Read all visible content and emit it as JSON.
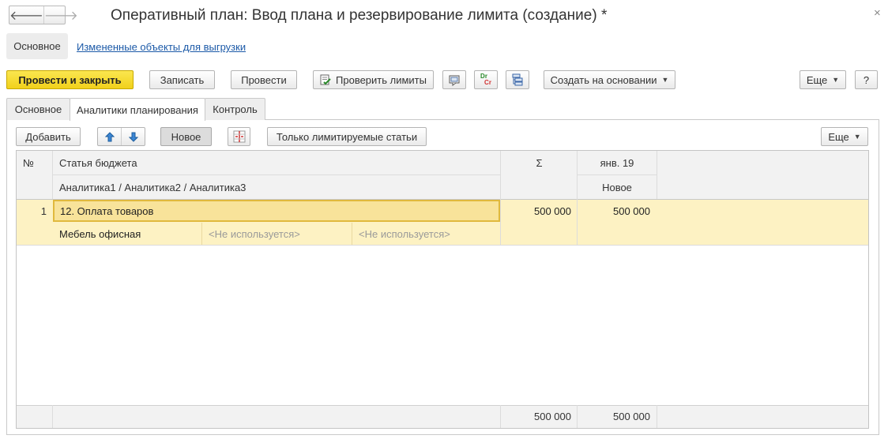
{
  "window": {
    "title": "Оперативный план: Ввод плана и резервирование лимита (создание) *",
    "back_glyph": "🡐",
    "forward_glyph": "🡒",
    "close_glyph": "×"
  },
  "nav_tabs": {
    "main": "Основное",
    "changed_objects": "Измененные объекты для выгрузки"
  },
  "toolbar": {
    "post_close": "Провести и закрыть",
    "save": "Записать",
    "post": "Провести",
    "check_limits": "Проверить лимиты",
    "create_based": "Создать на основании",
    "more": "Еще",
    "help": "?",
    "dr_label": "Dr",
    "cr_label": "Cr"
  },
  "inner_tabs": {
    "main": "Основное",
    "analytics": "Аналитики планирования",
    "control": "Контроль"
  },
  "table_toolbar": {
    "add": "Добавить",
    "new": "Новое",
    "only_limited": "Только лимитируемые статьи",
    "more": "Еще"
  },
  "table": {
    "headers": {
      "num": "№",
      "budget_item": "Статья бюджета",
      "analytics": "Аналитика1 / Аналитика2 / Аналитика3",
      "sum": "Σ",
      "period": "янв. 19",
      "period_sub": "Новое"
    },
    "rows": [
      {
        "num": "1",
        "budget_item": "12. Оплата товаров",
        "analytic1": "Мебель офисная",
        "analytic2": "<Не используется>",
        "analytic3": "<Не используется>",
        "sum": "500 000",
        "period": "500 000"
      }
    ],
    "footer": {
      "sum": "500 000",
      "period": "500 000"
    }
  },
  "colors": {
    "accent_yellow": "#f1d11b",
    "row_selected": "#fdf2c3",
    "link": "#1c5aa8"
  }
}
